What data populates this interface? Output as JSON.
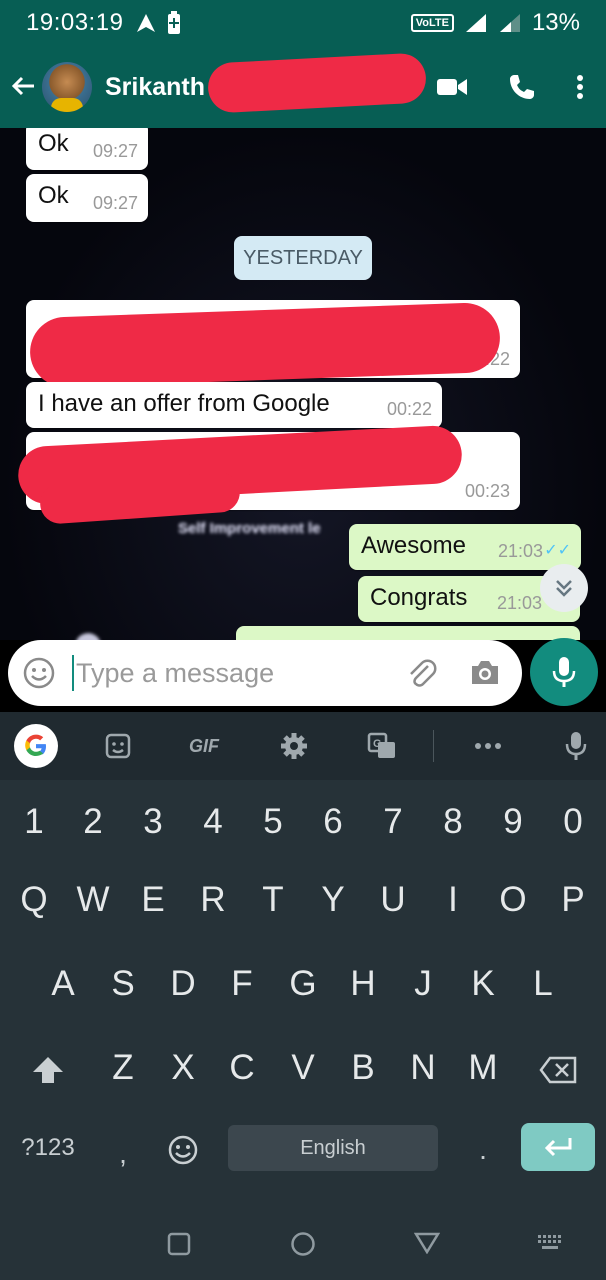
{
  "status": {
    "time": "19:03:19",
    "volte": "VoLTE",
    "battery": "13%"
  },
  "header": {
    "contact_name": "Srikanth"
  },
  "chat": {
    "messages": [
      {
        "text": "Ok",
        "time": "09:27",
        "dir": "in"
      },
      {
        "text": "Ok",
        "time": "09:27",
        "dir": "in"
      },
      {
        "text": "",
        "time": "00:22",
        "dir": "in",
        "redacted": true
      },
      {
        "text": "I have an offer from Google",
        "time": "00:22",
        "dir": "in"
      },
      {
        "text": "",
        "time": "00:23",
        "dir": "in",
        "redacted": true
      },
      {
        "text": "Awesome",
        "time": "21:03",
        "dir": "out"
      },
      {
        "text": "Congrats",
        "time": "21:03",
        "dir": "out"
      }
    ],
    "day_divider": "YESTERDAY",
    "wallpaper_text": "Self Improvement le"
  },
  "composer": {
    "placeholder": "Type a message"
  },
  "keyboard": {
    "toolbar": [
      "google-icon",
      "sticker-icon",
      "GIF",
      "gear-icon",
      "translate-icon",
      "more-icon",
      "mic-icon"
    ],
    "gif_label": "GIF",
    "row_numbers": [
      "1",
      "2",
      "3",
      "4",
      "5",
      "6",
      "7",
      "8",
      "9",
      "0"
    ],
    "row1": [
      "Q",
      "W",
      "E",
      "R",
      "T",
      "Y",
      "U",
      "I",
      "O",
      "P"
    ],
    "row2": [
      "A",
      "S",
      "D",
      "F",
      "G",
      "H",
      "J",
      "K",
      "L"
    ],
    "row3": [
      "Z",
      "X",
      "C",
      "V",
      "B",
      "N",
      "M"
    ],
    "symbols_key": "?123",
    "comma_key": ",",
    "period_key": ".",
    "space_label": "English"
  },
  "colors": {
    "header": "#075e54",
    "accent": "#128c7e",
    "outgoing": "#dcf8c6",
    "redaction": "#ef2a46"
  }
}
